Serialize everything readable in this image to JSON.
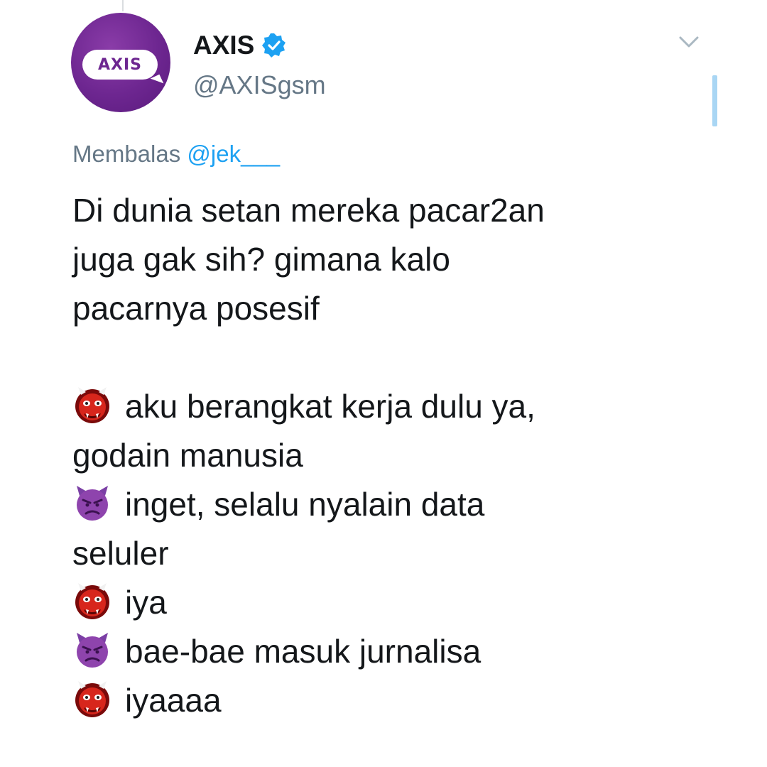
{
  "tweet": {
    "display_name": "AXIS",
    "handle": "@AXISgsm",
    "avatar_logo_text": "AXIS",
    "verified_icon": "verified-badge-icon",
    "menu_icon": "chevron-down-icon",
    "reply_prefix": "Membalas",
    "reply_mention": "@jek___",
    "body_lines": [
      "Di dunia setan mereka pacar2an",
      "juga gak sih? gimana kalo",
      "pacarnya posesif"
    ],
    "dialogue": [
      {
        "emoji": "ogre-emoji",
        "text": "aku berangkat kerja dulu ya,"
      },
      {
        "emoji": null,
        "text": "godain manusia"
      },
      {
        "emoji": "angry-face-with-horns-emoji",
        "text": "inget, selalu nyalain data"
      },
      {
        "emoji": null,
        "text": "seluler"
      },
      {
        "emoji": "ogre-emoji",
        "text": "iya"
      },
      {
        "emoji": "angry-face-with-horns-emoji",
        "text": "bae-bae masuk jurnalisa"
      },
      {
        "emoji": "ogre-emoji",
        "text": "iyaaaa"
      }
    ]
  },
  "colors": {
    "brand_purple": "#6d2690",
    "text_primary": "#14171a",
    "text_secondary": "#657786",
    "link_blue": "#1da1f2",
    "scroll_indicator": "#a9d6f4"
  }
}
